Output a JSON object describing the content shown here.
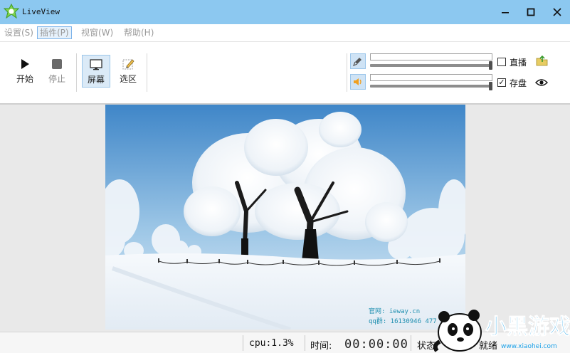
{
  "window": {
    "title": "LiveView"
  },
  "menu": {
    "items": [
      {
        "label": "设置(S)"
      },
      {
        "label": "插件(P)"
      },
      {
        "label": "视窗(W)"
      },
      {
        "label": "帮助(H)"
      }
    ],
    "active_index": 1
  },
  "toolbar": {
    "start_label": "开始",
    "stop_label": "停止",
    "screen_label": "屏幕",
    "region_label": "选区",
    "mic_level": 0.0,
    "mic_volume": 1.0,
    "speaker_level": 0.0,
    "speaker_volume": 1.0,
    "live_label": "直播",
    "live_checked": false,
    "save_label": "存盘",
    "save_checked": true,
    "icons": [
      "play-icon",
      "stop-icon",
      "monitor-icon",
      "region-edit-icon",
      "microphone-icon",
      "speaker-icon",
      "folder-icon",
      "eye-icon"
    ]
  },
  "preview": {
    "watermark_line1": "官网: ieway.cn",
    "watermark_line2": "qq群: 16130946  477"
  },
  "status": {
    "cpu": "cpu:1.3%",
    "time_label": "时间:",
    "time_value": "00:00:00",
    "state_label": "状态:",
    "state_value": "就绪"
  },
  "corner_logo": {
    "text": "小黑游戏",
    "url_text": "www.xiaohei.com"
  },
  "colors": {
    "titlebar": "#8cc8f0",
    "accent": "#7eb4ea",
    "sky_top": "#3f86c8",
    "snow": "#f4f7fb"
  }
}
